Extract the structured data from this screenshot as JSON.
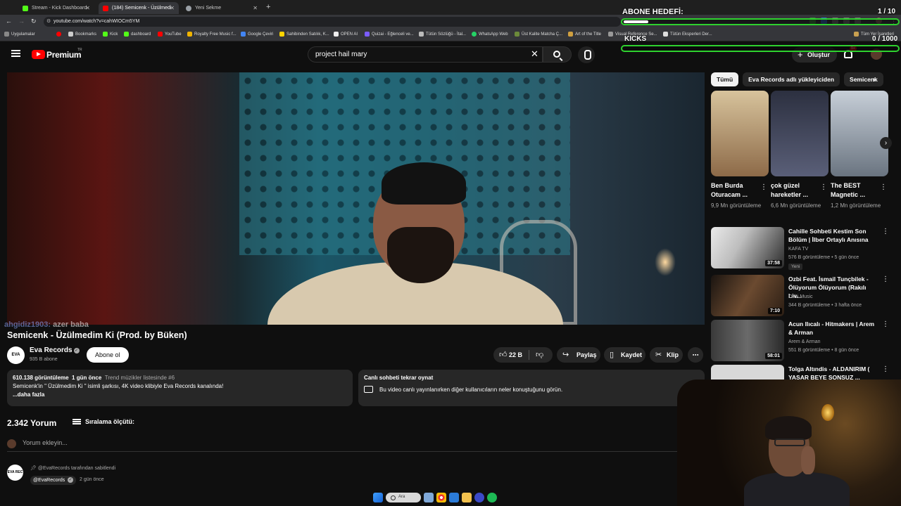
{
  "browser": {
    "tabs": [
      {
        "label": "Stream - Kick Dashboard",
        "favicon_color": "#53fc18",
        "active": false
      },
      {
        "label": "(184) Semicenk - Üzülmedi",
        "favicon_color": "#ff0000",
        "active": true
      },
      {
        "label": "Yeni Sekme",
        "favicon_color": "#9aa0a6",
        "active": false
      }
    ],
    "url": "youtube.com/watch?v=cahWIOCm5YM",
    "bookmarks": [
      "Uygulamalar",
      "Bookmarks",
      "Kick",
      "dashboard",
      "YouTube",
      "Royalty Free Music f...",
      "Google Çeviri",
      "Sahibinden Satılık, K...",
      "OPEN AI",
      "Quizai - Eğlenceli ve...",
      "Tütün Sözlüğü - İtal...",
      "WhatsApp Web",
      "Üst Kalite Matcha Ç...",
      "Art of the Title",
      "Visual Reference Se...",
      "Tütün Eksperleri Der...",
      "Tüm Yer İşaretleri"
    ]
  },
  "overlay": {
    "goal_title": "ABONE HEDEFİ:",
    "goal_count": "1 / 10",
    "goal_progress": 0.1,
    "kicks_title": "KICKS",
    "kicks_count": "0 / 1000",
    "kicks_progress": 0,
    "accent": "#2ed12e"
  },
  "yt": {
    "brand": "Premium",
    "country": "TR",
    "search_query": "project hail mary",
    "create_label": "Oluştur",
    "notif_count": "9+"
  },
  "video": {
    "chat_user": "ahgidiz1903:",
    "chat_msg": "azer baba",
    "title": "Semicenk - Üzülmedim Ki (Prod. by Büken)",
    "channel": "Eva Records",
    "channel_avatar_text": "EVA REC",
    "subs": "935 B abone",
    "subscribe_label": "Abone ol",
    "likes": "22 B",
    "share_label": "Paylaş",
    "save_label": "Kaydet",
    "clip_label": "Klip",
    "views": "610.138 görüntüleme",
    "date": "1 gün önce",
    "trend": "Trend müzikler listesinde #6",
    "description": "Semicenk'in \" Üzülmedim Ki \" isimli şarkısı, 4K video klibiyle Eva Records kanalında!",
    "more_label": "...daha fazla"
  },
  "live_chat": {
    "title": "Canlı sohbeti tekrar oynat",
    "desc": "Bu video canlı yayınlanırken diğer kullanıcıların neler konuştuğunu görün.",
    "button_label": "Pe"
  },
  "comments": {
    "count": "2.342 Yorum",
    "sort_label": "Sıralama ölçütü:",
    "add_placeholder": "Yorum ekleyin...",
    "pinned_by": "@EvaRecords tarafından sabitlendi",
    "pinned_handle": "@EvaRecords",
    "pinned_time": "2 gün önce"
  },
  "sidebar": {
    "chips": [
      "Tümü",
      "Eva Records adlı yükleyiciden",
      "Semicenk"
    ],
    "shorts": [
      {
        "title": "Ben Burda Oturacam ...",
        "views": "9,9 Mn görüntüleme",
        "color": "#b58a5c"
      },
      {
        "title": "çok güzel hareketler ...",
        "views": "6,6 Mn görüntüleme",
        "color": "#3a3f52"
      },
      {
        "title": "The BEST Magnetic ...",
        "views": "1,2 Mn görüntüleme",
        "color": "#8e9aa8"
      }
    ],
    "videos": [
      {
        "title": "Cahille Sohbeti Kestim Son Bölüm | İlber Ortaylı Anısına",
        "channel": "KAFA TV",
        "meta": "576 B görüntüleme • 5 gün önce",
        "badge": "Yeni",
        "duration": "37:58",
        "color": "#2b2b2b"
      },
      {
        "title": "Ozbi Feat. İsmail Tunçbilek - Ölüyorum Ölüyorum (Rakılı Liv...",
        "channel": "Ozbi Music",
        "meta": "344 B görüntüleme • 3 hafta önce",
        "badge": "",
        "duration": "7:10",
        "color": "#3a2a1f"
      },
      {
        "title": "Acun Ilıcalı - Hitmakers | Arem & Arman",
        "channel": "Arem & Arman",
        "meta": "551 B görüntüleme • 8 gün önce",
        "badge": "",
        "duration": "58:01",
        "color": "#4a4a4a"
      },
      {
        "title": "Tolga Altındis - ALDANIRIM ( YAŞAR BEYE SONSUZ ...",
        "channel": "",
        "meta": "",
        "badge": "",
        "duration": "",
        "color": "#d8d8d8"
      }
    ]
  },
  "taskbar": {
    "search_label": "Ara"
  }
}
